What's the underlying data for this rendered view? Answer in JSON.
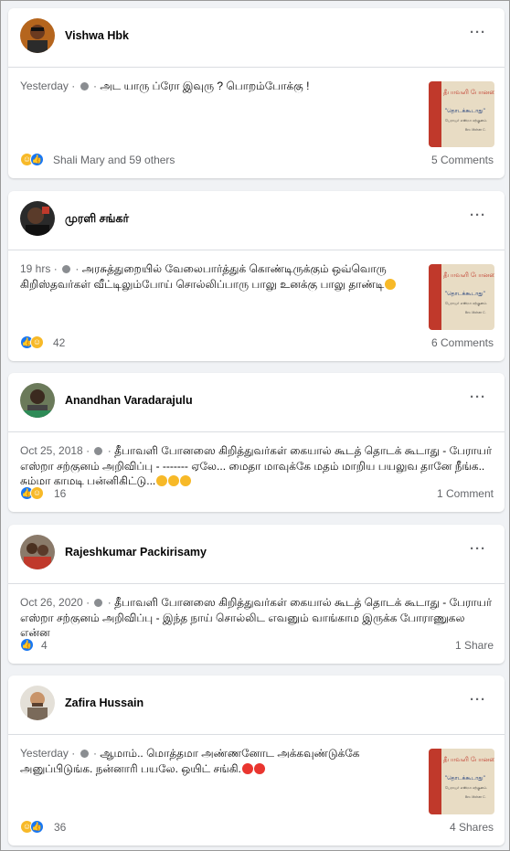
{
  "posts": [
    {
      "author": "Vishwa Hbk",
      "time": "Yesterday",
      "separator": "·",
      "text": "அட யாரு ப்ரோ இவுரு ? பொறம்போக்கு !",
      "reactions": [
        "haha",
        "like"
      ],
      "reaction_count": "Shali Mary and 59 others",
      "footer_right": "5 Comments",
      "has_thumbnail": true
    },
    {
      "author": "முரளி சங்கர்",
      "time": "19 hrs",
      "separator": "·",
      "text": "அரசுத்துறையில் வேலைபார்த்துக் கொண்டிருக்கும் ஒவ்வொரு கிறிஸ்தவர்கள் வீட்டிலும்போய் சொல்லிப்பாரு பாலு உனக்கு பாலு தாண்டி",
      "trailing_emoji": [
        "haha"
      ],
      "reactions": [
        "like",
        "haha"
      ],
      "reaction_count": "42",
      "footer_right": "6 Comments",
      "has_thumbnail": true
    },
    {
      "author": "Anandhan Varadarajulu",
      "time": "Oct 25, 2018",
      "separator": "·",
      "text": "தீபாவளி போனஸை கிறித்துவர்கள் கையால் கூடத் தொடக் கூடாது - பேராயர் எஸ்றா சற்குனம் அறிவிப்பு - ------- ஏலே... மைதா மாவுக்கே மதம் மாறிய பயலுவ தானே நீங்க.. சும்மா காமடி பன்னிகிட்டு...",
      "trailing_emoji": [
        "haha",
        "haha",
        "haha"
      ],
      "reactions": [
        "like",
        "haha"
      ],
      "reaction_count": "16",
      "footer_right": "1 Comment",
      "has_thumbnail": false
    },
    {
      "author": "Rajeshkumar Packirisamy",
      "time": "Oct 26, 2020",
      "separator": "·",
      "text": "தீபாவளி போனஸை கிறித்துவர்கள் கையால் கூடத் தொடக் கூடாது - பேராயர் எஸ்றா சற்குனம் அறிவிப்பு - இந்த நாய் சொல்லிட எவனும் வாங்காம இருக்க போராணுகல என்ன",
      "reactions": [
        "like"
      ],
      "reaction_count": "4",
      "footer_right": "1 Share",
      "has_thumbnail": false
    },
    {
      "author": "Zafira Hussain",
      "time": "Yesterday",
      "separator": "·",
      "text": "ஆமாம்.. மொத்தமா அண்ணனோட அக்கவுண்டுக்கே அனுப்பிடுங்க. நன்னாரி பயலே. ஒயிட் சங்கி.",
      "trailing_emoji": [
        "angry",
        "angry"
      ],
      "reactions": [
        "haha",
        "like"
      ],
      "reaction_count": "36",
      "footer_right": "4 Shares",
      "has_thumbnail": true
    }
  ],
  "more_label": "···",
  "thumbnail": {
    "title": "தீபாவளி போனஸை",
    "quote": "\"தொடக்கூடாது\"",
    "caption": "பேராயர் எஸ்றா சற்குனம்",
    "byline": "Bro. Mohan C."
  }
}
